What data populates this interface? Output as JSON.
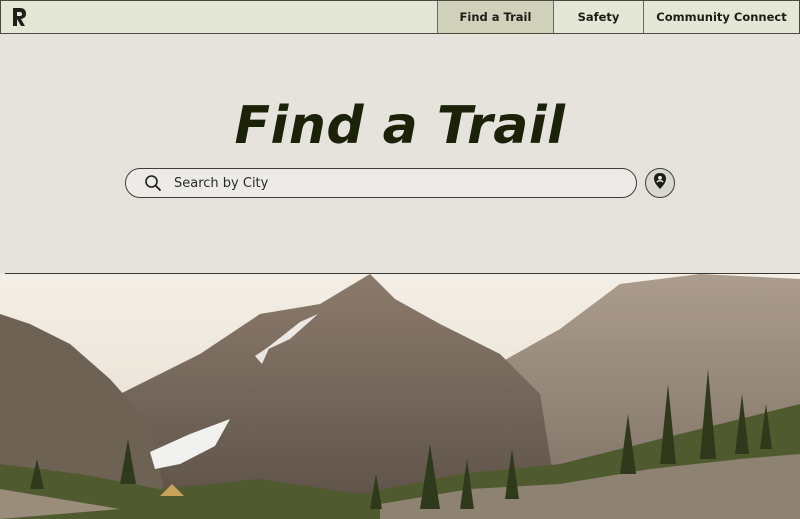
{
  "nav": {
    "logo_icon": "trail-logo-icon",
    "items": [
      {
        "label": "Find a Trail",
        "active": true
      },
      {
        "label": "Safety",
        "active": false
      },
      {
        "label": "Community Connect",
        "active": false
      }
    ]
  },
  "page": {
    "title": "Find a Trail"
  },
  "search": {
    "placeholder": "Search by City",
    "icon": "search-icon"
  },
  "location_button": {
    "icon": "location-pin-icon"
  },
  "colors": {
    "nav_bg": "#e5e7d6",
    "nav_active_bg": "#cfd1bb",
    "page_bg": "#e6e3dd",
    "title": "#1c2208"
  }
}
